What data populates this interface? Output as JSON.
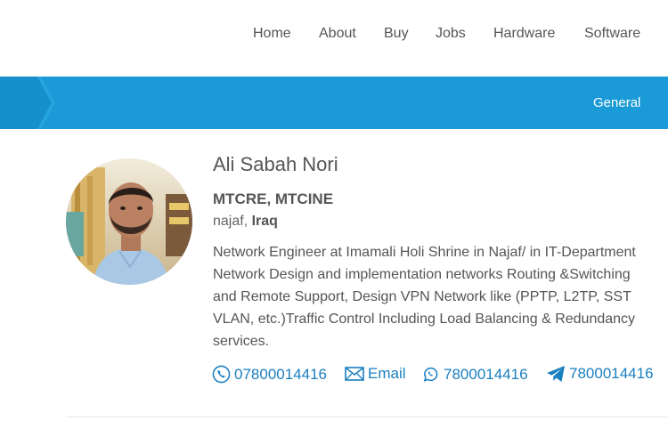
{
  "nav": {
    "items": [
      {
        "label": "Home"
      },
      {
        "label": "About"
      },
      {
        "label": "Buy"
      },
      {
        "label": "Jobs"
      },
      {
        "label": "Hardware"
      },
      {
        "label": "Software"
      }
    ]
  },
  "band": {
    "label": "General",
    "color": "#1a9ad6"
  },
  "profile": {
    "name": "Ali Sabah Nori",
    "certs": "MTCRE, MTCINE",
    "city": "najaf,",
    "country": "Iraq",
    "bio_lines": [
      "Network Engineer at Imamali Holi Shrine in Najaf/ in IT-Department",
      "Network Design and implementation networks Routing &Switching",
      "and Remote Support, Design VPN Network like (PPTP, L2TP, SST",
      "VLAN, etc.)Traffic Control Including Load Balancing & Redundancy",
      "services."
    ]
  },
  "contacts": {
    "phone": {
      "icon": "phone-icon",
      "label": "07800014416"
    },
    "email": {
      "icon": "envelope-icon",
      "label": "Email"
    },
    "whatsapp": {
      "icon": "whatsapp-icon",
      "label": "7800014416"
    },
    "telegram": {
      "icon": "telegram-icon",
      "label": "7800014416"
    }
  },
  "colors": {
    "link": "#1a7fc0",
    "text": "#555555"
  }
}
